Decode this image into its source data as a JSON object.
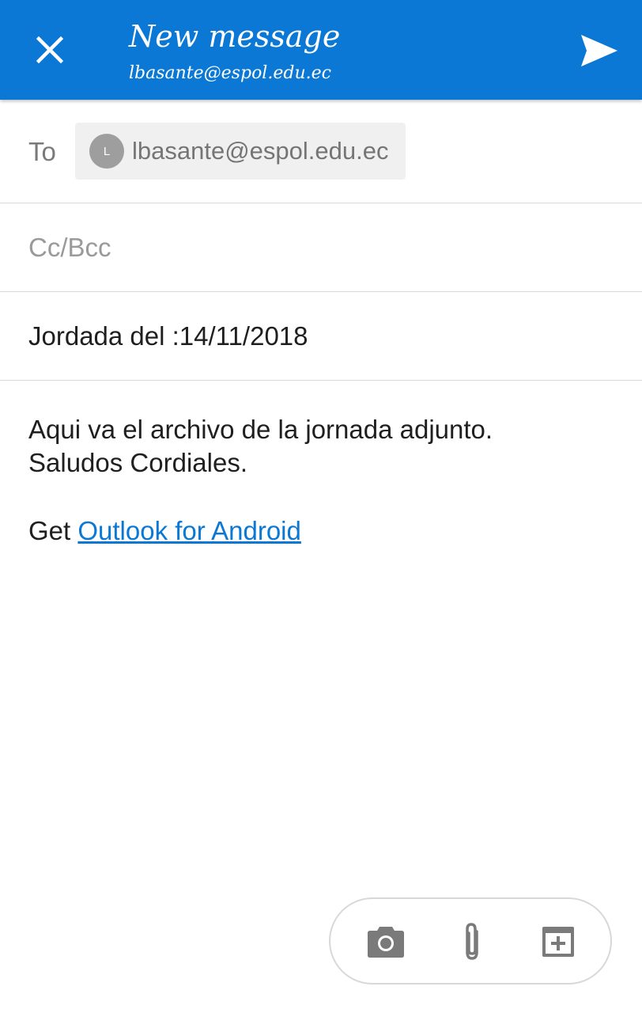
{
  "header": {
    "title": "New message",
    "account": "lbasante@espol.edu.ec",
    "close_icon": "close-icon",
    "send_icon": "send-icon",
    "background_color": "#0a78d4"
  },
  "to_row": {
    "label": "To",
    "recipient": {
      "initial": "L",
      "email": "lbasante@espol.edu.ec"
    }
  },
  "cc_row": {
    "placeholder": "Cc/Bcc"
  },
  "subject": {
    "value": "Jordada del :14/11/2018"
  },
  "body": {
    "line1": "Aqui va el archivo de la jornada adjunto.",
    "line2": "Saludos Cordiales.",
    "signature_prefix": "Get ",
    "signature_link": "Outlook for Android",
    "link_color": "#0a78d4"
  },
  "toolbar": {
    "icons": [
      "camera-icon",
      "paperclip-icon",
      "insert-icon"
    ]
  }
}
